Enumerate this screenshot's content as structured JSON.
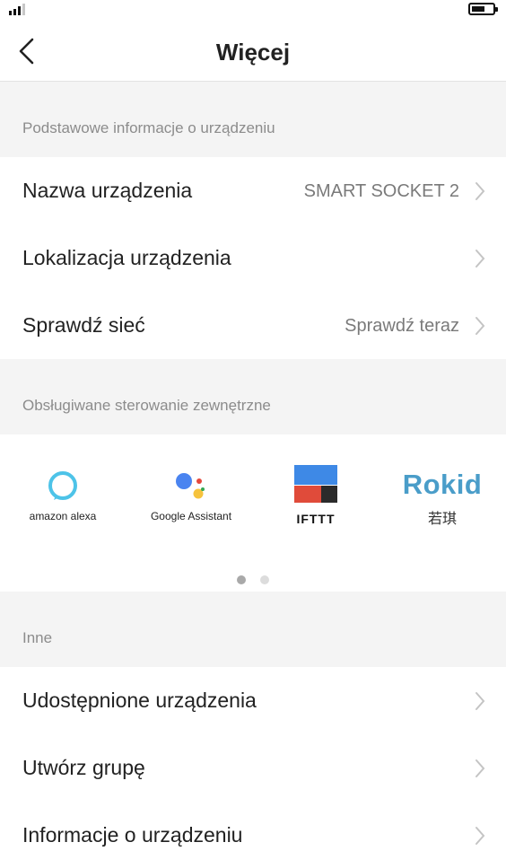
{
  "nav": {
    "title": "Więcej"
  },
  "section_basic": {
    "header": "Podstawowe informacje o urządzeniu",
    "rows": [
      {
        "label": "Nazwa urządzenia",
        "value": "SMART SOCKET 2"
      },
      {
        "label": "Lokalizacja urządzenia",
        "value": ""
      },
      {
        "label": "Sprawdź sieć",
        "value": "Sprawdź teraz"
      }
    ]
  },
  "section_external": {
    "header": "Obsługiwane sterowanie zewnętrzne",
    "integrations": [
      {
        "name": "amazon alexa",
        "icon": "alexa-ring-icon"
      },
      {
        "name": "Google Assistant",
        "icon": "google-assistant-icon"
      },
      {
        "name": "IFTTT",
        "icon": "ifttt-icon"
      },
      {
        "name": "Rokid",
        "subtitle": "若琪",
        "icon": "rokid-logo"
      }
    ],
    "pagination": {
      "current": 1,
      "total": 2
    }
  },
  "section_other": {
    "header": "Inne",
    "rows": [
      {
        "label": "Udostępnione urządzenia"
      },
      {
        "label": "Utwórz grupę"
      },
      {
        "label": "Informacje o urządzeniu"
      }
    ]
  },
  "colors": {
    "alexa": "#4dc3e8",
    "rokid": "#4a9dc9",
    "ifttt_blue": "#3e89e6",
    "ifttt_red": "#e04b3a"
  }
}
